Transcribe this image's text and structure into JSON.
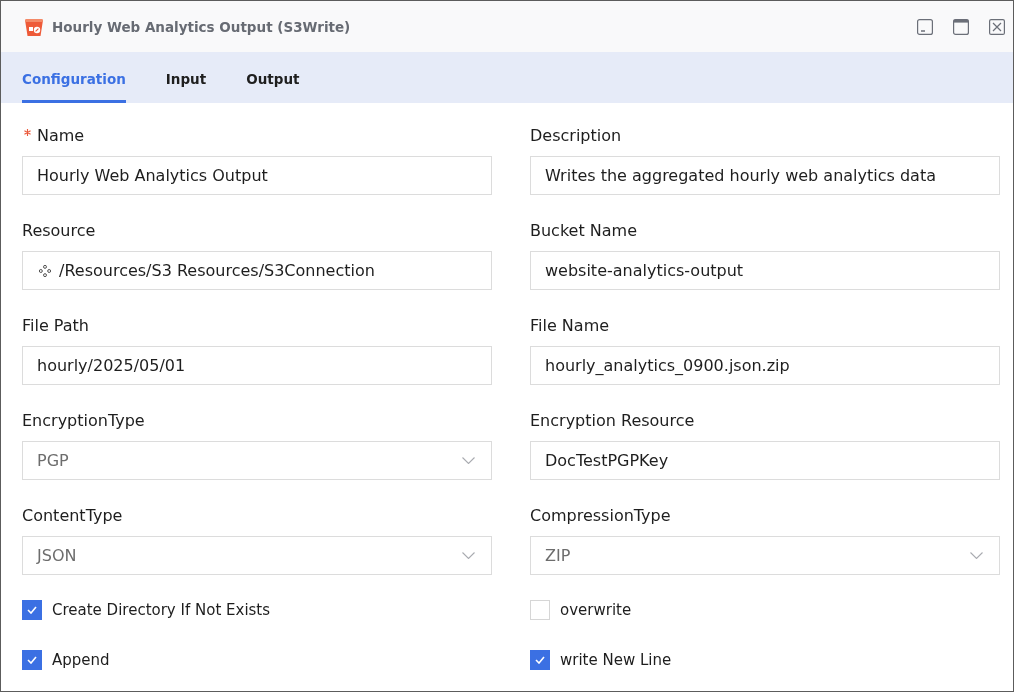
{
  "window": {
    "title": "Hourly Web Analytics Output (S3Write)"
  },
  "tabs": [
    {
      "label": "Configuration",
      "selected": true
    },
    {
      "label": "Input",
      "selected": false
    },
    {
      "label": "Output",
      "selected": false
    }
  ],
  "fields": [
    {
      "kind": "text",
      "label": "Name",
      "required": true,
      "value": "Hourly Web Analytics Output"
    },
    {
      "kind": "text",
      "label": "Description",
      "required": false,
      "value": "Writes the aggregated hourly web analytics data"
    },
    {
      "kind": "resource",
      "label": "Resource",
      "required": false,
      "value": "/Resources/S3 Resources/S3Connection"
    },
    {
      "kind": "text",
      "label": "Bucket Name",
      "required": false,
      "value": "website-analytics-output"
    },
    {
      "kind": "text",
      "label": "File Path",
      "required": false,
      "value": "hourly/2025/05/01"
    },
    {
      "kind": "text",
      "label": "File Name",
      "required": false,
      "value": "hourly_analytics_0900.json.zip"
    },
    {
      "kind": "dropdown",
      "label": "EncryptionType",
      "required": false,
      "value": "PGP"
    },
    {
      "kind": "text",
      "label": "Encryption Resource",
      "required": false,
      "value": "DocTestPGPKey"
    },
    {
      "kind": "dropdown",
      "label": "ContentType",
      "required": false,
      "value": "JSON"
    },
    {
      "kind": "dropdown",
      "label": "CompressionType",
      "required": false,
      "value": "ZIP"
    }
  ],
  "checkboxes": [
    {
      "label": "Create Directory If Not Exists",
      "checked": true
    },
    {
      "label": "overwrite",
      "checked": false
    },
    {
      "label": "Append",
      "checked": true
    },
    {
      "label": "write New Line",
      "checked": true
    }
  ]
}
